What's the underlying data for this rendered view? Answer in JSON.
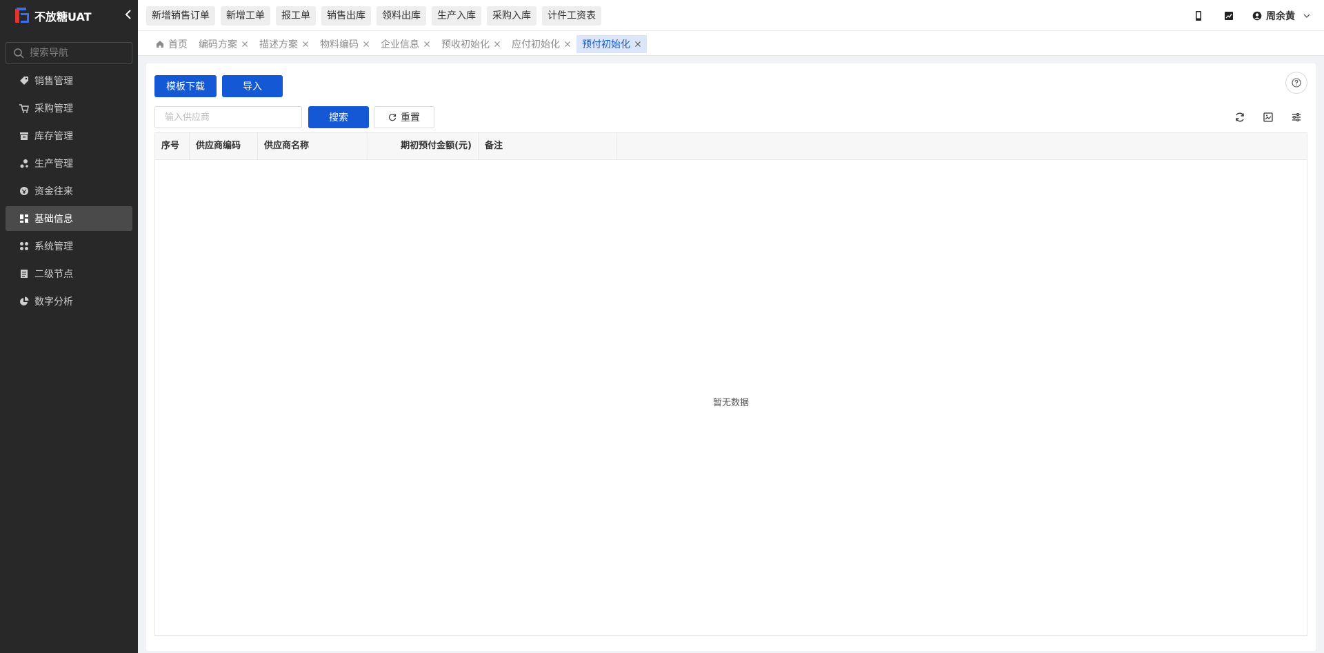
{
  "sidebar": {
    "logo_title": "不放糖UAT",
    "search_placeholder": "搜索导航",
    "menu": [
      {
        "label": "销售管理",
        "icon": "tag-icon"
      },
      {
        "label": "采购管理",
        "icon": "cart-icon"
      },
      {
        "label": "库存管理",
        "icon": "archive-icon"
      },
      {
        "label": "生产管理",
        "icon": "production-icon"
      },
      {
        "label": "资金往来",
        "icon": "funds-icon"
      },
      {
        "label": "基础信息",
        "icon": "dashboard-icon",
        "active": true
      },
      {
        "label": "系统管理",
        "icon": "apps-icon"
      },
      {
        "label": "二级节点",
        "icon": "document-icon"
      },
      {
        "label": "数字分析",
        "icon": "pie-chart-icon"
      }
    ]
  },
  "topbar": {
    "quick_actions": [
      "新增销售订单",
      "新增工单",
      "报工单",
      "销售出库",
      "领料出库",
      "生产入库",
      "采购入库",
      "计件工资表"
    ],
    "user_name": "周余黄"
  },
  "tabs": {
    "items": [
      "首页",
      "编码方案",
      "描述方案",
      "物料编码",
      "企业信息",
      "预收初始化",
      "应付初始化",
      "预付初始化"
    ],
    "active_index": 7
  },
  "main": {
    "template_download_label": "模板下载",
    "import_label": "导入",
    "supplier_placeholder": "输入供应商",
    "search_label": "搜索",
    "reset_label": "重置",
    "table": {
      "columns": [
        "序号",
        "供应商编码",
        "供应商名称",
        "期初预付金额(元)",
        "备注"
      ],
      "rows": [],
      "empty_text": "暂无数据"
    }
  },
  "colors": {
    "primary": "#1458d6",
    "sidebar_bg": "#282828",
    "active_tab_bg": "#dbe6fb"
  }
}
